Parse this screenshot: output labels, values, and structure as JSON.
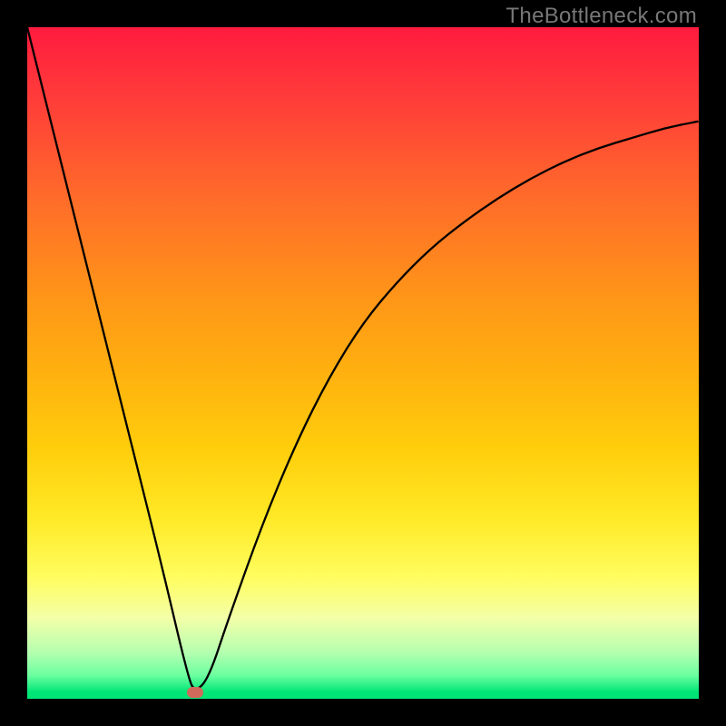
{
  "watermark": "TheBottleneck.com",
  "colors": {
    "frame": "#000000",
    "curve": "#000000",
    "marker": "#d06b5c",
    "gradient_top": "#ff1b3f",
    "gradient_bottom": "#00e676"
  },
  "chart_data": {
    "type": "line",
    "title": "",
    "xlabel": "",
    "ylabel": "",
    "xlim": [
      0,
      100
    ],
    "ylim": [
      0,
      100
    ],
    "grid": false,
    "legend": false,
    "series": [
      {
        "name": "bottleneck-curve",
        "x": [
          0,
          5,
          10,
          15,
          20,
          24,
          25,
          27,
          30,
          35,
          40,
          45,
          50,
          55,
          60,
          65,
          70,
          75,
          80,
          85,
          90,
          95,
          100
        ],
        "values": [
          100,
          80,
          60,
          40,
          20,
          3,
          1,
          3,
          12,
          26,
          38,
          48,
          56,
          62,
          67,
          71,
          74.5,
          77.5,
          80,
          82,
          83.5,
          85,
          86
        ]
      }
    ],
    "marker": {
      "x": 25,
      "y": 1
    }
  }
}
